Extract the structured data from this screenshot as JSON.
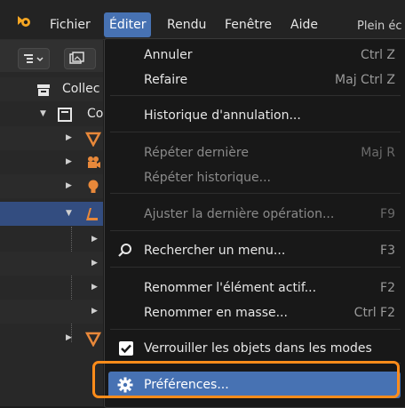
{
  "menubar": {
    "items": [
      "Fichier",
      "Éditer",
      "Rendu",
      "Fenêtre",
      "Aide"
    ],
    "active": "Éditer",
    "right_clip": "Plein éc"
  },
  "outliner": {
    "rows": [
      {
        "label": "Collec"
      },
      {
        "label": "Co"
      }
    ]
  },
  "edit_menu": {
    "items": [
      {
        "label": "Annuler",
        "shortcut": "Ctrl Z",
        "enabled": true
      },
      {
        "label": "Refaire",
        "shortcut": "Maj Ctrl Z",
        "enabled": true
      },
      {
        "label": "Historique d'annulation...",
        "shortcut": "",
        "enabled": true
      },
      {
        "label": "Répéter dernière",
        "shortcut": "Maj R",
        "enabled": false
      },
      {
        "label": "Répéter historique...",
        "shortcut": "",
        "enabled": false
      },
      {
        "label": "Ajuster la dernière opération...",
        "shortcut": "F9",
        "enabled": false
      },
      {
        "label": "Rechercher un menu...",
        "shortcut": "F3",
        "enabled": true,
        "icon": "search-icon"
      },
      {
        "label": "Renommer l'élément actif...",
        "shortcut": "F2",
        "enabled": true
      },
      {
        "label": "Renommer en masse...",
        "shortcut": "Ctrl F2",
        "enabled": true
      },
      {
        "label": "Verrouiller les objets dans les modes",
        "shortcut": "",
        "enabled": true,
        "checked": true
      },
      {
        "label": "Préférences...",
        "shortcut": "",
        "enabled": true,
        "highlighted": true,
        "icon": "gear-icon"
      }
    ]
  },
  "colors": {
    "menu_highlight": "#4772b3",
    "annotation_frame": "#ff8c1a",
    "object_icon": "#e8883a"
  }
}
